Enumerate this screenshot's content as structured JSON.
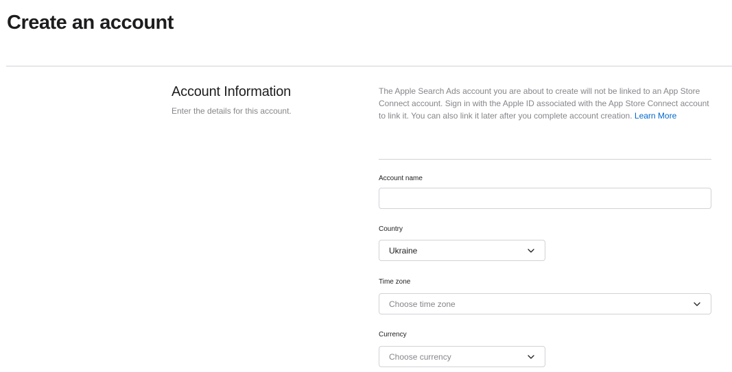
{
  "header": {
    "title": "Create an account"
  },
  "section": {
    "title": "Account Information",
    "subtitle": "Enter the details for this account."
  },
  "notice": {
    "text": "The Apple Search Ads account you are about to create will not be linked to an App Store Connect account. Sign in with the Apple ID associated with the App Store Connect account to link it. You can also link it later after you complete account creation.",
    "link_label": "Learn More"
  },
  "form": {
    "account_name": {
      "label": "Account name",
      "value": "",
      "placeholder": ""
    },
    "country": {
      "label": "Country",
      "selected": "Ukraine"
    },
    "time_zone": {
      "label": "Time zone",
      "placeholder": "Choose time zone"
    },
    "currency": {
      "label": "Currency",
      "placeholder": "Choose currency"
    }
  },
  "icons": {
    "select_chevron": "chevron-down-icon"
  },
  "colors": {
    "link": "#0066cc",
    "muted_text": "#86868b",
    "border": "#d2d2d7"
  }
}
